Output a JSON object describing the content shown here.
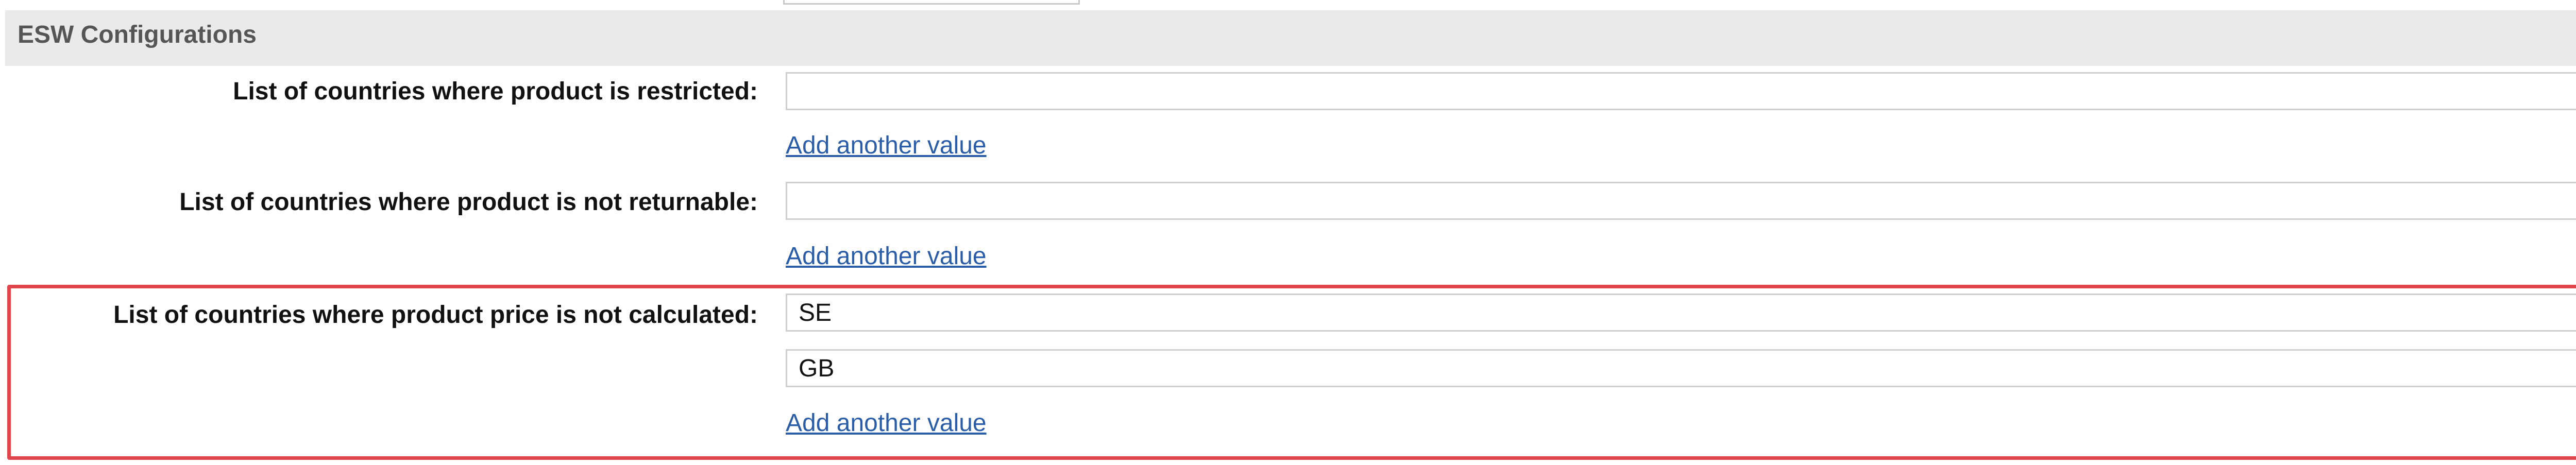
{
  "section": {
    "title": "ESW Configurations"
  },
  "rows": [
    {
      "label": "List of countries where product is restricted:",
      "values": [
        ""
      ],
      "add_link": "Add another value"
    },
    {
      "label": "List of countries where product is not returnable:",
      "values": [
        ""
      ],
      "add_link": "Add another value"
    },
    {
      "label": "List of countries where product price is not calculated:",
      "values": [
        "SE",
        "GB"
      ],
      "add_link": "Add another value",
      "highlighted": true
    }
  ],
  "colors": {
    "highlight": "#e0454b",
    "link": "#2a5da8",
    "header_bg": "#eaeaea"
  }
}
